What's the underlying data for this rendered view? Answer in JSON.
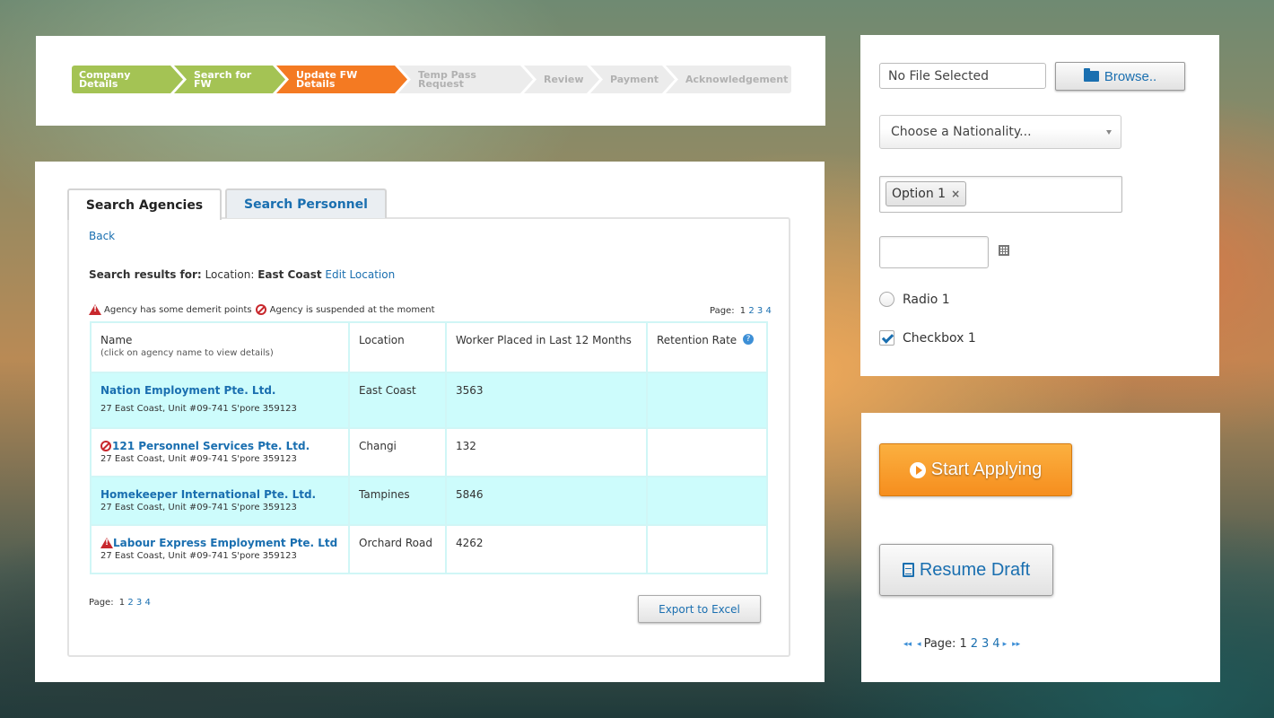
{
  "stepper": {
    "steps": [
      {
        "label": "Company Details",
        "state": "done"
      },
      {
        "label": "Search for FW",
        "state": "done"
      },
      {
        "label": "Update FW Details",
        "state": "active"
      },
      {
        "label": "Temp Pass Request",
        "state": "pending"
      },
      {
        "label": "Review",
        "state": "pending"
      },
      {
        "label": "Payment",
        "state": "pending"
      },
      {
        "label": "Acknowledgement",
        "state": "pending"
      }
    ]
  },
  "tabs": [
    {
      "label": "Search Agencies",
      "active": true
    },
    {
      "label": "Search Personnel",
      "active": false
    }
  ],
  "back_label": "Back",
  "search_summary": {
    "prefix": "Search results for:",
    "field": "Location:",
    "value": "East Coast",
    "edit_label": "Edit Location"
  },
  "legend": {
    "demerit": "Agency has some demerit points",
    "suspended": "Agency is suspended at the moment"
  },
  "pager": {
    "label": "Page:",
    "current": "1",
    "pages": [
      "2",
      "3",
      "4"
    ]
  },
  "table": {
    "headers": {
      "name": "Name",
      "name_hint": "(click on agency name to view details)",
      "location": "Location",
      "workers": "Worker Placed in Last 12 Months",
      "retention": "Retention Rate",
      "help": "?"
    },
    "rows": [
      {
        "name": "Nation Employment Pte. Ltd.",
        "address": "27 East Coast, Unit #09-741 S'pore 359123",
        "location": "East Coast",
        "workers": "3563",
        "retention": "",
        "flag": "none"
      },
      {
        "name": "121 Personnel Services Pte. Ltd.",
        "address": "27 East Coast, Unit #09-741 S'pore 359123",
        "location": "Changi",
        "workers": "132",
        "retention": "",
        "flag": "suspended"
      },
      {
        "name": "Homekeeper International Pte. Ltd.",
        "address": "27 East Coast, Unit #09-741 S'pore 359123",
        "location": "Tampines",
        "workers": "5846",
        "retention": "",
        "flag": "none"
      },
      {
        "name": "Labour Express Employment Pte. Ltd",
        "address": "27 East Coast, Unit #09-741 S'pore 359123",
        "location": "Orchard Road",
        "workers": "4262",
        "retention": "",
        "flag": "demerit"
      }
    ]
  },
  "export_label": "Export to Excel",
  "form": {
    "file_placeholder": "No File Selected",
    "browse_label": "Browse..",
    "nationality_placeholder": "Choose a Nationality...",
    "selected_chip": "Option 1",
    "chip_remove": "×",
    "radio_label": "Radio 1",
    "checkbox_label": "Checkbox 1"
  },
  "actions": {
    "start_label": "Start Applying",
    "resume_label": "Resume Draft"
  },
  "pager_right": {
    "first": "◂◂",
    "prev": "◂",
    "label": "Page:",
    "current": "1",
    "pages": [
      "2",
      "3",
      "4"
    ],
    "next": "▸",
    "last": "▸▸"
  },
  "colors": {
    "link": "#1a6fb0",
    "step_done": "#a4c354",
    "step_active": "#f47a22",
    "highlight_row": "#cdfcfc",
    "primary_button": "#f68e1e",
    "alert": "#c8282d"
  }
}
